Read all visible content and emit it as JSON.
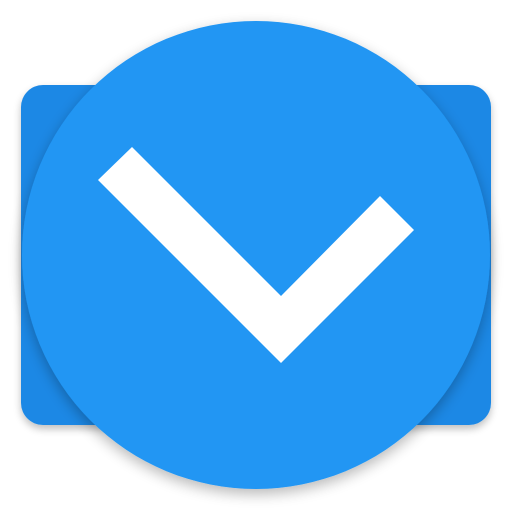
{
  "icon": {
    "name": "checkmark-icon",
    "shape": "circle-on-rounded-square",
    "colors": {
      "background": "#ffffff",
      "back_square": "#1E88E5",
      "back_square_shade": "#1976D2",
      "circle": "#2196F3",
      "checkmark": "#FFFFFF",
      "shadow": "#000000"
    }
  }
}
